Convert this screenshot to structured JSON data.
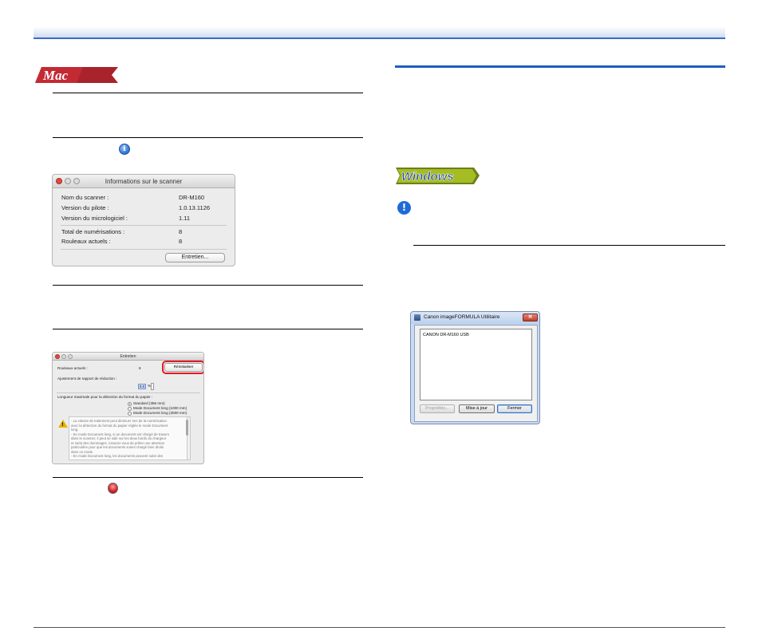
{
  "badges": {
    "mac_label": "Mac",
    "windows_label": "Windows"
  },
  "icons": {
    "info": "info-icon",
    "info_glyph": "i",
    "stop": "red-stop-icon",
    "warning": "exclamation-icon",
    "warning_glyph": "!",
    "caution": "caution-triangle-icon",
    "caution_glyph": "!"
  },
  "scanner_info_window": {
    "title": "Informations sur le scanner",
    "rows": [
      {
        "label": "Nom du scanner :",
        "value": "DR-M160"
      },
      {
        "label": "Version du pilote :",
        "value": "1.0.13.1126"
      },
      {
        "label": "Version du micrologiciel :",
        "value": "1.11"
      },
      {
        "label": "Total de numérisations :",
        "value": "8"
      },
      {
        "label": "Rouleaux actuels :",
        "value": "8"
      }
    ],
    "maintenance_button": "Entretien..."
  },
  "maintenance_window": {
    "title": "Entretien",
    "current_rollers_label": "Rouleaux actuels :",
    "current_rollers_value": "8",
    "reset_button": "Réinitialiser",
    "ratio_label": "Ajustement de rapport de réduction :",
    "ratio_value": "0.0",
    "ratio_unit": "%",
    "max_length_label": "Longueur maximale pour la détection du format du papier :",
    "options": [
      {
        "label": "Standard (356 mm)",
        "selected": true
      },
      {
        "label": "Mode Document long (1000 mm)",
        "selected": false
      },
      {
        "label": "Mode Document long (3000 mm)",
        "selected": false
      }
    ],
    "notes": [
      "- La vitesse de traitement peut diminuer lors de la numérisation",
      "avec la détection du format du papier réglée le mode Document",
      "long.",
      "- En mode Document long, si un document est chargé de travers",
      "dans le scanner, il peut se salir sur les deux bords du chargeur",
      "et subir des dommages. Assurez-vous de prêter une attention",
      "particulière pour que les documents soient chargé bien droits",
      "dans ce mode.",
      "- En mode Document long, les documents peuvent subir des"
    ]
  },
  "windows_dialog": {
    "title": "Canon imageFORMULA Utilitaire",
    "close_glyph": "✕",
    "list_items": [
      "CANON DR-M160 USB"
    ],
    "buttons": {
      "properties": "Propriétés...",
      "update": "Mise à jour",
      "close": "Fermer"
    }
  }
}
